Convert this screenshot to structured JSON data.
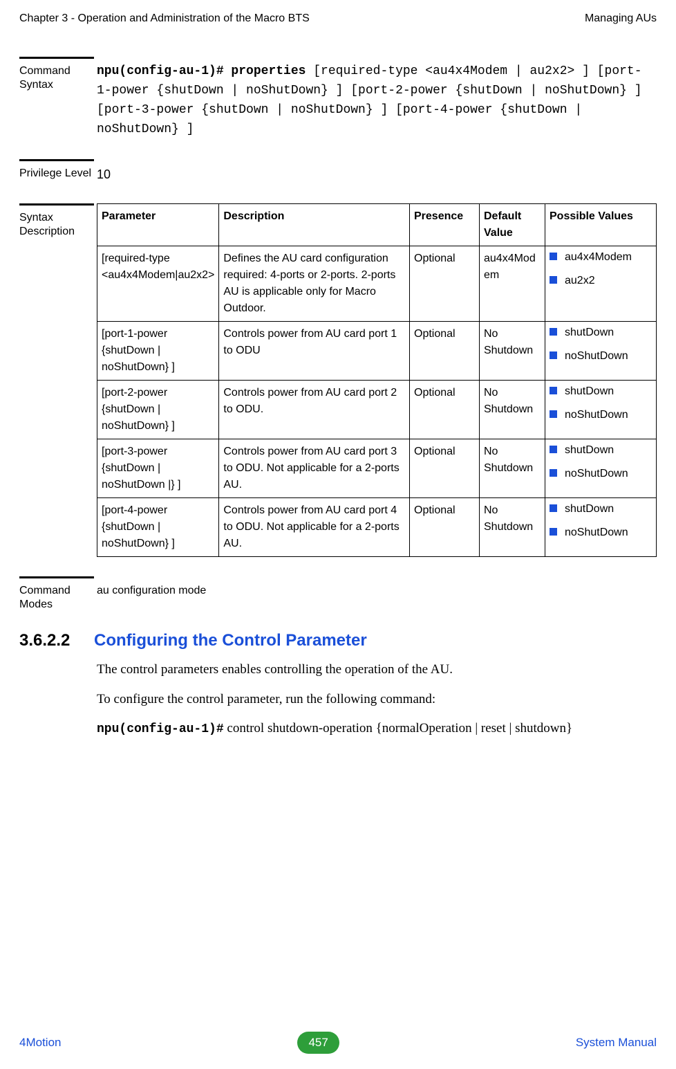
{
  "header": {
    "left": "Chapter 3 - Operation and Administration of the Macro BTS",
    "right": "Managing AUs"
  },
  "blocks": {
    "command_syntax_label": "Command Syntax",
    "command_syntax_bold": "npu(config-au-1)# properties",
    "command_syntax_rest": " [required-type <au4x4Modem | au2x2> ] [port-1-power {shutDown | noShutDown} ] [port-2-power {shutDown | noShutDown} ] [port-3-power {shutDown | noShutDown} ] [port-4-power {shutDown | noShutDown} ]",
    "privilege_label": "Privilege Level",
    "privilege_value": "10",
    "syntax_label": "Syntax Description",
    "command_modes_label": "Command Modes",
    "command_modes_value": "au configuration mode"
  },
  "table": {
    "headers": {
      "param": "Parameter",
      "desc": "Description",
      "presence": "Presence",
      "default": "Default Value",
      "possible": "Possible Values"
    },
    "rows": [
      {
        "param": "[required-type <au4x4Modem|au2x2>",
        "desc": "Defines the AU card configuration required: 4-ports or 2-ports. 2-ports AU is applicable only for Macro Outdoor.",
        "presence": "Optional",
        "default": "au4x4Modem",
        "values": [
          "au4x4Modem",
          "au2x2"
        ]
      },
      {
        "param": "[port-1-power {shutDown | noShutDown} ]",
        "desc": "Controls power from AU card port 1 to ODU",
        "presence": "Optional",
        "default": "No Shutdown",
        "values": [
          "shutDown",
          "noShutDown"
        ]
      },
      {
        "param": "[port-2-power {shutDown | noShutDown} ]",
        "desc": "Controls power from AU card port 2 to ODU.",
        "presence": "Optional",
        "default": "No Shutdown",
        "values": [
          "shutDown",
          "noShutDown"
        ]
      },
      {
        "param": "[port-3-power {shutDown | noShutDown |} ]",
        "desc": "Controls power from AU card port 3 to ODU. Not applicable for a 2-ports AU.",
        "presence": "Optional",
        "default": "No Shutdown",
        "values": [
          "shutDown",
          "noShutDown"
        ]
      },
      {
        "param": "[port-4-power {shutDown | noShutDown} ]",
        "desc": "Controls power from AU card port 4 to ODU. Not applicable for a 2-ports AU.",
        "presence": "Optional",
        "default": "No Shutdown",
        "values": [
          "shutDown",
          "noShutDown"
        ]
      }
    ]
  },
  "section": {
    "number": "3.6.2.2",
    "title": "Configuring the Control Parameter",
    "para1": "The control parameters enables controlling the operation of the AU.",
    "para2": "To configure the control parameter, run the following command:",
    "cmd_bold": "npu(config-au-1)#",
    "cmd_rest": " control shutdown-operation {normalOperation | reset | shutdown}"
  },
  "footer": {
    "left": "4Motion",
    "page": "457",
    "right": "System Manual"
  }
}
